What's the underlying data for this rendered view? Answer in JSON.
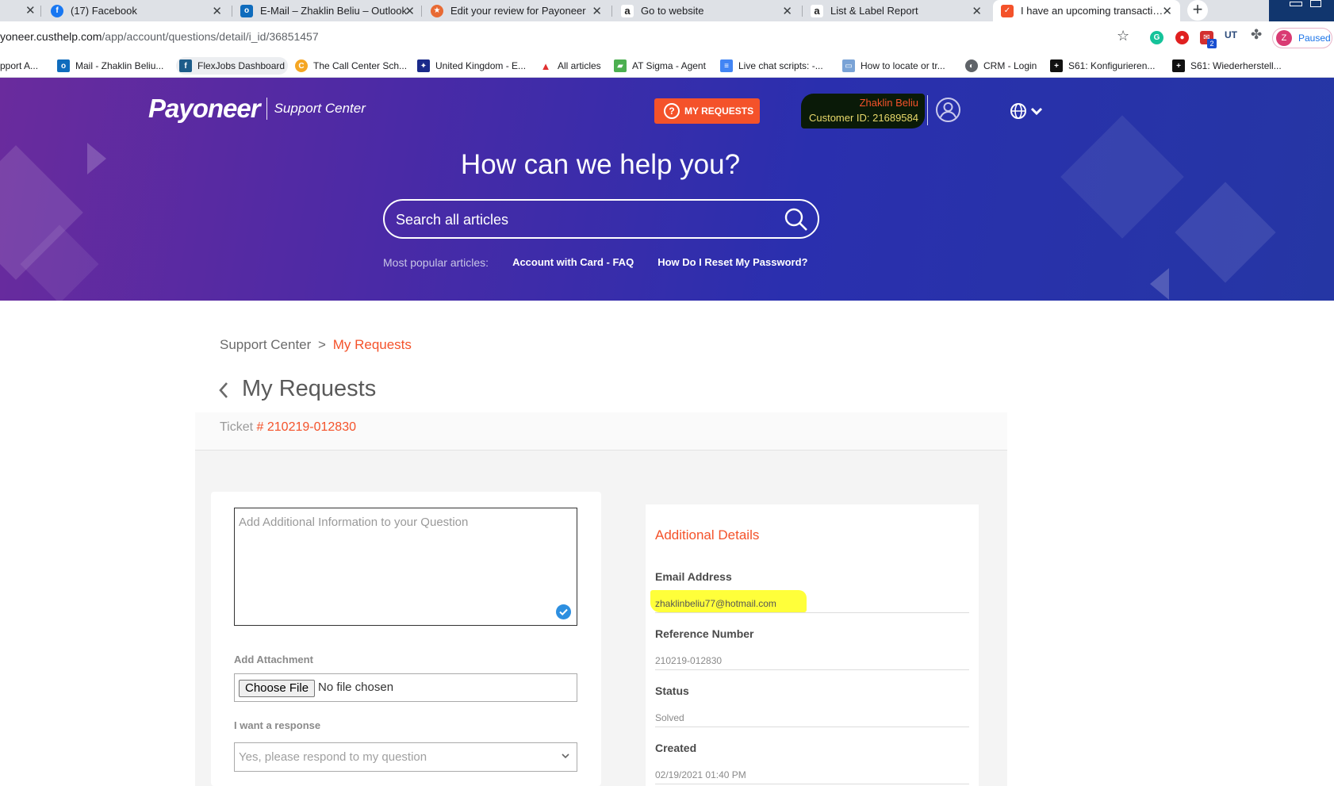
{
  "browser": {
    "tabs": [
      {
        "title": "(17) Facebook",
        "icon": "facebook-icon",
        "color": "#1877f2"
      },
      {
        "title": "E-Mail – Zhaklin Beliu – Outlook",
        "icon": "outlook-icon",
        "color": "#0f6cbd"
      },
      {
        "title": "Edit your review for Payoneer",
        "icon": "review-icon",
        "color": "#e86a33"
      },
      {
        "title": "Go to website",
        "icon": "amazon-icon",
        "color": "#222222"
      },
      {
        "title": "List & Label Report",
        "icon": "amazon-icon",
        "color": "#222222"
      },
      {
        "title": "I have an upcoming transaction c",
        "icon": "payoneer-icon",
        "color": "#f4522a"
      }
    ],
    "url_host": "yoneer.custhelp.com",
    "url_path": "/app/account/questions/detail/i_id/36851457",
    "profile_initial": "Z",
    "profile_label": "Paused",
    "ext_badge": "2",
    "bookmarks": [
      {
        "label": "pport A...",
        "icon": "none"
      },
      {
        "label": "Mail - Zhaklin Beliu...",
        "icon": "outlook-icon"
      },
      {
        "label": "FlexJobs Dashboard",
        "icon": "flexjobs-icon"
      },
      {
        "label": "The Call Center Sch...",
        "icon": "callcenter-icon"
      },
      {
        "label": "United Kingdom - E...",
        "icon": "eu-icon"
      },
      {
        "label": "All articles",
        "icon": "articles-icon"
      },
      {
        "label": "AT Sigma - Agent",
        "icon": "sigma-icon"
      },
      {
        "label": "Live chat scripts: -...",
        "icon": "docs-icon"
      },
      {
        "label": "How to locate or tr...",
        "icon": "locate-icon"
      },
      {
        "label": "CRM - Login",
        "icon": "globe-icon"
      },
      {
        "label": "S61: Konfigurieren...",
        "icon": "s61-icon"
      },
      {
        "label": "S61: Wiederherstell...",
        "icon": "s61-icon"
      }
    ]
  },
  "header": {
    "brand": "Payoneer",
    "support_center": "Support Center",
    "my_requests_btn": "MY REQUESTS",
    "user_name": "Zhaklin Beliu",
    "customer_id": "Customer ID:  21689584",
    "hero_title": "How can we help you?",
    "search_placeholder": "Search all articles",
    "popular_label": "Most popular articles:",
    "popular_links": [
      "Account with Card - FAQ",
      "How Do I Reset My Password?"
    ]
  },
  "content": {
    "breadcrumb_root": "Support Center",
    "breadcrumb_sep": ">",
    "breadcrumb_current": "My Requests",
    "page_title": "My Requests",
    "ticket_label": "Ticket",
    "ticket_number": "# 210219-012830",
    "form": {
      "textarea_placeholder": "Add Additional Information to your Question",
      "attachment_label": "Add Attachment",
      "choose_file": "Choose File",
      "no_file": "No file chosen",
      "response_label": "I want a response",
      "response_value": "Yes, please respond to my question"
    },
    "details": {
      "title": "Additional Details",
      "items": [
        {
          "label": "Email Address",
          "value": "zhaklinbeliu77@hotmail.com"
        },
        {
          "label": "Reference Number",
          "value": "210219-012830"
        },
        {
          "label": "Status",
          "value": "Solved"
        },
        {
          "label": "Created",
          "value": "02/19/2021 01:40 PM"
        }
      ]
    }
  },
  "colors": {
    "accent": "#f4522a",
    "hero_start": "#6a2b9d",
    "hero_end": "#2536a4",
    "highlight": "#ffff3a"
  }
}
